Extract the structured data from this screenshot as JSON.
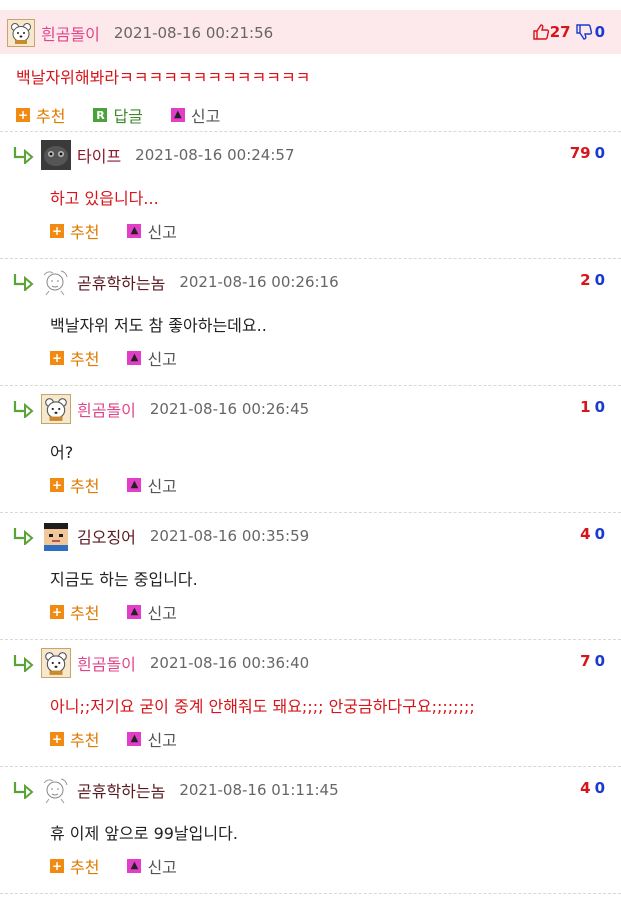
{
  "comments": [
    {
      "nick": "흰곰돌이",
      "date": "2021-08-16 00:21:56",
      "up": "27",
      "down": "0",
      "body": "백날자위해봐라ㅋㅋㅋㅋㅋㅋㅋㅋㅋㅋㅋㅋㅋ",
      "recommend": "추천",
      "reply": "답글",
      "report": "신고"
    },
    {
      "nick": "타이프",
      "date": "2021-08-16 00:24:57",
      "up": "79",
      "down": "0",
      "body": "하고 있읍니다...",
      "recommend": "추천",
      "report": "신고"
    },
    {
      "nick": "곧휴학하는놈",
      "date": "2021-08-16 00:26:16",
      "up": "2",
      "down": "0",
      "body": "백날자위 저도 참 좋아하는데요..",
      "recommend": "추천",
      "report": "신고"
    },
    {
      "nick": "흰곰돌이",
      "date": "2021-08-16 00:26:45",
      "up": "1",
      "down": "0",
      "body": "어?",
      "recommend": "추천",
      "report": "신고"
    },
    {
      "nick": "김오징어",
      "date": "2021-08-16 00:35:59",
      "up": "4",
      "down": "0",
      "body": "지금도 하는 중입니다.",
      "recommend": "추천",
      "report": "신고"
    },
    {
      "nick": "흰곰돌이",
      "date": "2021-08-16 00:36:40",
      "up": "7",
      "down": "0",
      "body": "아니;;저기요 굳이 중계 안해줘도 돼요;;;; 안궁금하다구요;;;;;;;;",
      "recommend": "추천",
      "report": "신고"
    },
    {
      "nick": "곧휴학하는놈",
      "date": "2021-08-16 01:11:45",
      "up": "4",
      "down": "0",
      "body": "휴 이제 앞으로 99날입니다.",
      "recommend": "추천",
      "report": "신고"
    }
  ],
  "icons": {
    "reply_arrow": "reply-arrow-icon",
    "thumbs_up": "thumbs-up-icon",
    "thumbs_down": "thumbs-down-icon",
    "recommend": "plus-icon",
    "reply": "r-icon",
    "report": "siren-icon"
  },
  "colors": {
    "header_bg": "#fde8ec",
    "up_red": "#d7141a",
    "down_blue": "#1a3ad0",
    "recommend_orange": "#f08a10",
    "reply_green": "#4aa33a",
    "report_magenta": "#e23ec8"
  }
}
